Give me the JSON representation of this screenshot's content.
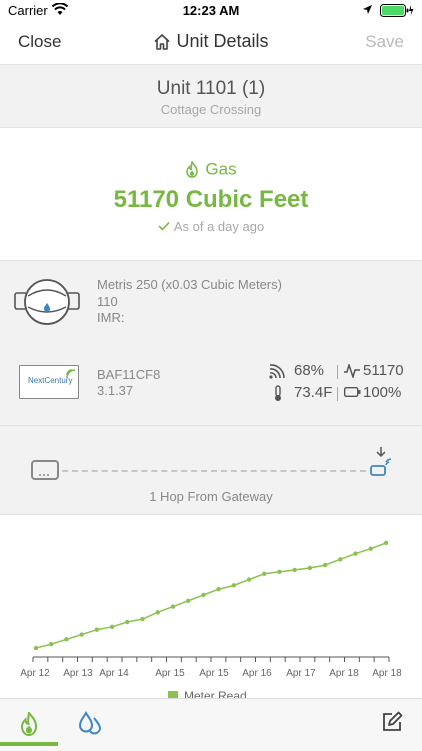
{
  "status_bar": {
    "carrier": "Carrier",
    "time": "12:23 AM"
  },
  "nav": {
    "close_label": "Close",
    "title": "Unit Details",
    "save_label": "Save"
  },
  "unit": {
    "name": "Unit 1101 (1)",
    "location": "Cottage Crossing"
  },
  "reading": {
    "utility": "Gas",
    "value": "51170 Cubic Feet",
    "as_of": "As of a day ago",
    "accent": "#77b843"
  },
  "meter": {
    "model": "Metris 250 (x0.03 Cubic Meters)",
    "size": "110",
    "imr": "IMR:"
  },
  "radio": {
    "logo": "NextCentury",
    "id": "BAF11CF8",
    "firmware": "3.1.37",
    "signal": "68%",
    "last_reading": "51170",
    "temperature": "73.4F",
    "battery": "100%"
  },
  "hops": {
    "label": "1 Hop From Gateway"
  },
  "chart_data": {
    "type": "line",
    "x_tick_labels": [
      "Apr 12",
      "Apr 13",
      "Apr 14",
      "Apr 15",
      "Apr 15",
      "Apr 16",
      "Apr 17",
      "Apr 18",
      "Apr 18"
    ],
    "series": [
      {
        "name": "Meter Read",
        "color": "#8cc152",
        "values": [
          1,
          5,
          10,
          15,
          20,
          23,
          28,
          31,
          38,
          44,
          50,
          56,
          62,
          66,
          72,
          78,
          80,
          82,
          84,
          87,
          93,
          99,
          104,
          110
        ]
      }
    ],
    "legend": "bottom-center",
    "grid": false
  },
  "tabbar": {
    "tabs": [
      "gas-icon",
      "water-icon"
    ],
    "edit": "edit-icon"
  }
}
